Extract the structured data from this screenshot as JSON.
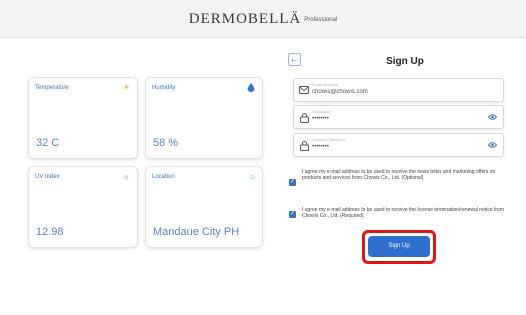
{
  "header": {
    "brand_name": "DERMOBELLÄ",
    "brand_sub": "Professional"
  },
  "cards": [
    {
      "title": "Temperature",
      "value": "32 C",
      "icon": "sun-icon",
      "icon_glyph": "☀",
      "icon_color": "#e6a23c"
    },
    {
      "title": "Humidity",
      "value": "58 %",
      "icon": "water-drop-icon",
      "icon_glyph": "💧",
      "icon_color": "#3d74c4"
    },
    {
      "title": "UV Index",
      "value": "12.98",
      "icon": "uv-icon",
      "icon_glyph": "☼",
      "icon_color": "#7a7a7a"
    },
    {
      "title": "Location",
      "value": "Mandaue City PH",
      "icon": "location-icon",
      "icon_glyph": "⌂",
      "icon_color": "#5aa86a"
    }
  ],
  "form": {
    "title": "Sign Up",
    "back_icon": "arrow-left-icon",
    "email": {
      "label": "Email Address",
      "value": "chowis@chowis.com"
    },
    "password": {
      "label": "Password",
      "value": "••••••••"
    },
    "confirm_password": {
      "label": "Confirm Password",
      "value": "••••••••"
    },
    "consent_optional": "I agree my e-mail address to be used to receive the news letter and marketing offers on products and services from Chowis Co., Ltd. (Optional)",
    "consent_required": "I agree my e-mail address to be used to receive the license termination/renewal notice from Chowis Co., Ltd. (Required)",
    "submit_label": "Sign Up"
  },
  "colors": {
    "accent": "#2f6fd0",
    "highlight": "#e01515",
    "header_bg": "#f3f3f3"
  }
}
